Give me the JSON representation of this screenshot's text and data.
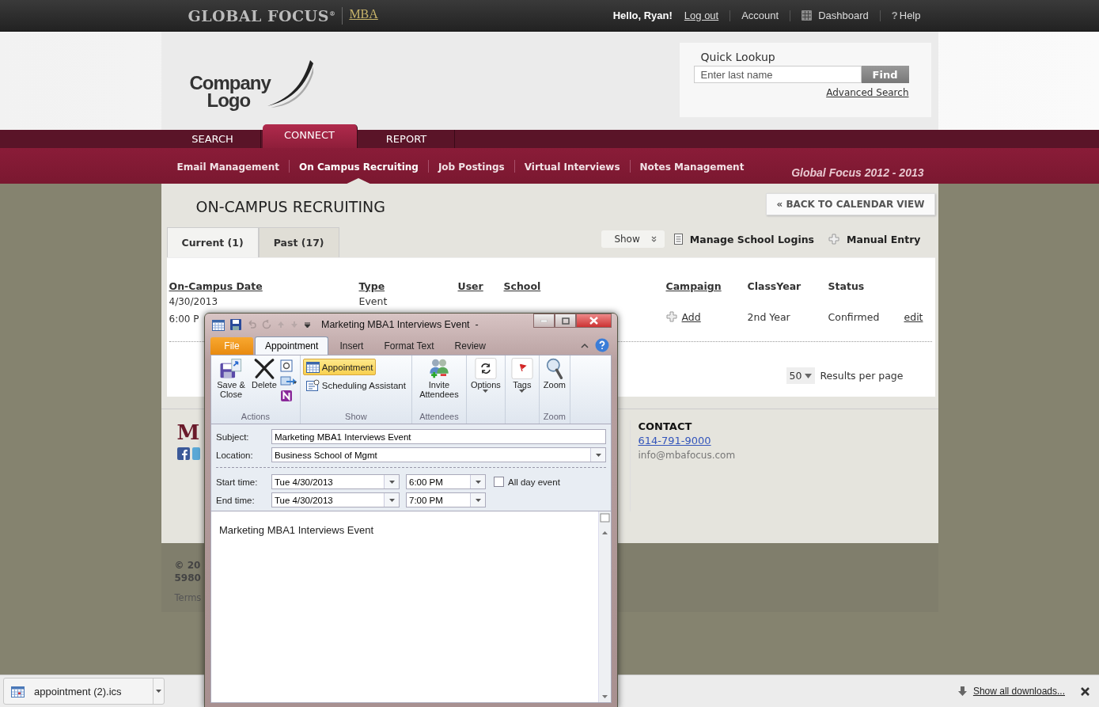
{
  "top_bar": {
    "brand": "GLOBAL FOCUS$^{®}$",
    "sub_brand": "MBA",
    "greeting": "Hello, Ryan!",
    "links": [
      {
        "label": "Log out",
        "kind": "link"
      },
      {
        "label": "Account",
        "kind": "plain"
      },
      {
        "label": "Dashboard",
        "kind": "dashboard"
      },
      {
        "label": "Help",
        "kind": "help",
        "icon_char": "?"
      }
    ]
  },
  "header": {
    "logo_lines": [
      "Company",
      "Logo"
    ],
    "quick_lookup": {
      "title": "Quick Lookup",
      "placeholder": "Enter last name",
      "button": "Find",
      "link": "Advanced Search"
    }
  },
  "nav": {
    "tabs": [
      {
        "label": "SEARCH",
        "selected": false
      },
      {
        "label": "CONNECT",
        "selected": true
      },
      {
        "label": "REPORT",
        "selected": false
      }
    ],
    "subnav": [
      {
        "label": "Email Management",
        "selected": false
      },
      {
        "label": "On Campus Recruiting",
        "selected": true
      },
      {
        "label": "Job Postings",
        "selected": false
      },
      {
        "label": "Virtual Interviews",
        "selected": false
      },
      {
        "label": "Notes Management",
        "selected": false
      }
    ],
    "season": "Global Focus 2012 - 2013"
  },
  "section": {
    "title": "ON-CAMPUS RECRUITING",
    "back_button": "« BACK TO CALENDAR VIEW",
    "tabs": [
      {
        "label": "Current (1)",
        "selected": true
      },
      {
        "label": "Past (17)",
        "selected": false
      }
    ],
    "show_menu": "Show",
    "actions": [
      {
        "label": "Manage School Logins",
        "kind": "list"
      },
      {
        "label": "Manual Entry",
        "kind": "add"
      }
    ]
  },
  "table": {
    "columns": [
      {
        "label": "On-Campus Date",
        "sortable": true
      },
      {
        "label": "Type",
        "sortable": true
      },
      {
        "label": "User",
        "sortable": true
      },
      {
        "label": "School",
        "sortable": true
      },
      {
        "label": "Campaign",
        "sortable": true
      },
      {
        "label": "ClassYear",
        "sortable": false
      },
      {
        "label": "Status",
        "sortable": false
      }
    ],
    "rows": [
      {
        "date": "4/30/2013",
        "time": "6:00 P",
        "type": "Event",
        "campaign": "Add",
        "class_year": "2nd Year",
        "status": "Confirmed",
        "action": "edit"
      }
    ],
    "page_size": "50",
    "page_size_label": "Results per page"
  },
  "footer": {
    "logo": "M",
    "contact": {
      "title": "CONTACT",
      "phone": "614-791-9000",
      "email": "info@mbafocus.com"
    },
    "copyright": "© 20",
    "address": "5980",
    "terms": "Terms"
  },
  "downloads_bar": {
    "file": "appointment (2).ics",
    "show_all": "Show all downloads..."
  },
  "outlook_window": {
    "title": "Marketing MBA1 Interviews Event  -",
    "ribbon_tabs": [
      {
        "label": "File",
        "kind": "file",
        "selected": false
      },
      {
        "label": "Appointment",
        "kind": "tab",
        "selected": true
      },
      {
        "label": "Insert",
        "kind": "tab",
        "selected": false
      },
      {
        "label": "Format Text",
        "kind": "tab",
        "selected": false
      },
      {
        "label": "Review",
        "kind": "tab",
        "selected": false
      }
    ],
    "groups": [
      {
        "label": "Actions",
        "buttons": [
          {
            "label": "Save & Close",
            "kind": "save"
          },
          {
            "label": "Delete",
            "kind": "delete"
          },
          {
            "kind": "small-stack"
          }
        ]
      },
      {
        "label": "Show",
        "buttons": [
          {
            "label": "Appointment",
            "kind": "show",
            "selected": true
          },
          {
            "label": "Scheduling Assistant",
            "kind": "show",
            "selected": false
          }
        ]
      },
      {
        "label": "Attendees",
        "buttons": [
          {
            "label": "Invite Attendees",
            "kind": "invite"
          }
        ]
      },
      {
        "buttons": [
          {
            "label": "Options",
            "kind": "options"
          }
        ]
      },
      {
        "buttons": [
          {
            "label": "Tags",
            "kind": "tags"
          }
        ]
      },
      {
        "label": "Zoom",
        "buttons": [
          {
            "label": "Zoom",
            "kind": "zoom"
          }
        ]
      }
    ],
    "subject_label": "Subject:",
    "subject": "Marketing MBA1 Interviews Event",
    "location_label": "Location:",
    "location": "Business School of Mgmt",
    "start_label": "Start time:",
    "start_date": "Tue 4/30/2013",
    "start_time": "6:00 PM",
    "all_day": {
      "label": "All day event",
      "checked": false
    },
    "end_label": "End time:",
    "end_date": "Tue 4/30/2013",
    "end_time": "7:00 PM",
    "body": "Marketing MBA1 Interviews Event"
  }
}
